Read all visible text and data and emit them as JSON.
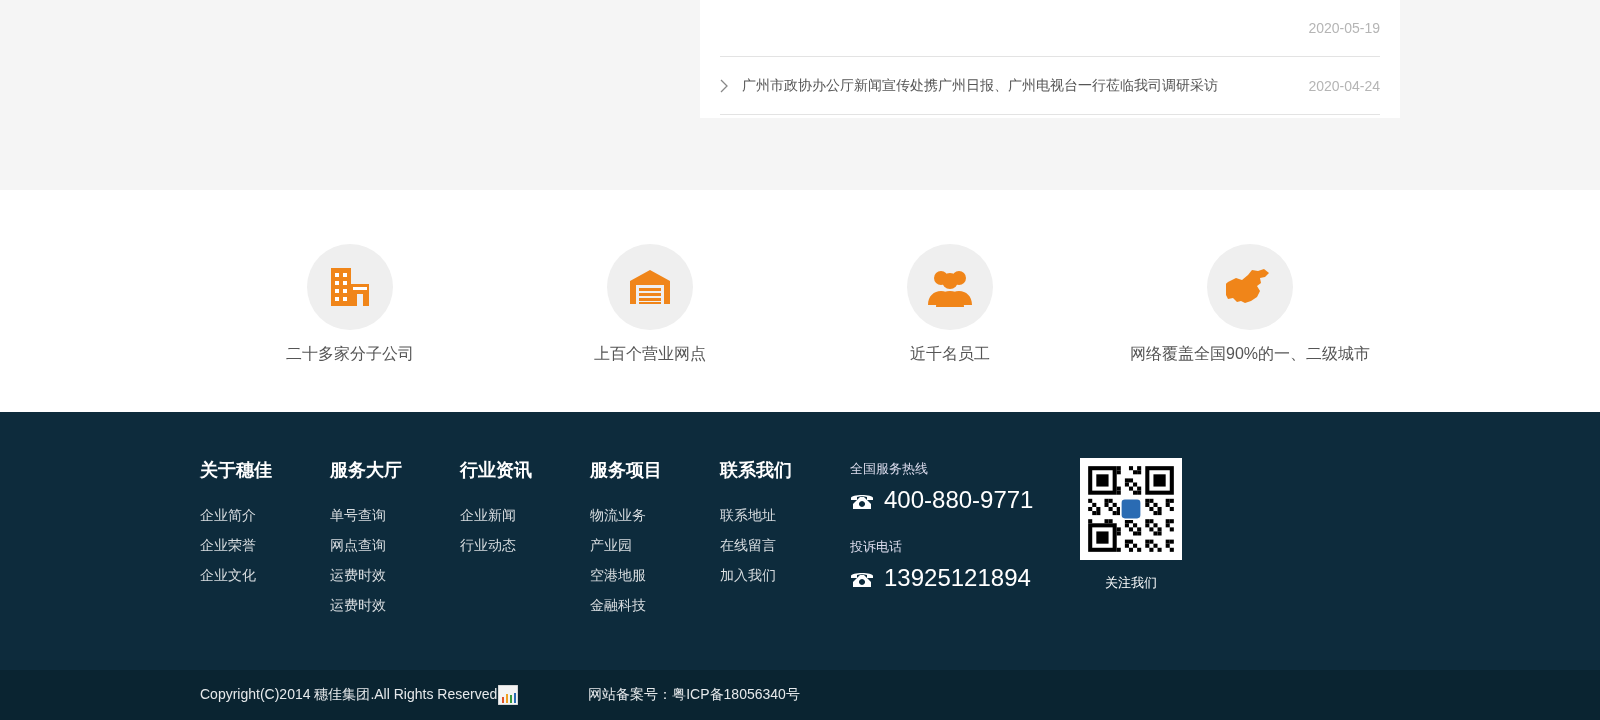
{
  "news": [
    {
      "date": "2020-05-19",
      "arrow": false
    },
    {
      "title": "广州市政协办公厅新闻宣传处携广州日报、广州电视台一行莅临我司调研采访",
      "date": "2020-04-24",
      "arrow": true
    }
  ],
  "stats": [
    {
      "kind": "building",
      "label": "二十多家分子公司"
    },
    {
      "kind": "garage",
      "label": "上百个营业网点"
    },
    {
      "kind": "people",
      "label": "近千名员工"
    },
    {
      "kind": "map",
      "label": "网络覆盖全国90%的一、二级城市"
    }
  ],
  "footer": {
    "columns": [
      {
        "title": "关于穗佳",
        "links": [
          "企业简介",
          "企业荣誉",
          "企业文化"
        ]
      },
      {
        "title": "服务大厅",
        "links": [
          "单号查询",
          "网点查询",
          "运费时效",
          "运费时效"
        ]
      },
      {
        "title": "行业资讯",
        "links": [
          "企业新闻",
          "行业动态"
        ]
      },
      {
        "title": "服务项目",
        "links": [
          "物流业务",
          "产业园",
          "空港地服",
          "金融科技"
        ]
      },
      {
        "title": "联系我们",
        "links": [
          "联系地址",
          "在线留言",
          "加入我们"
        ]
      }
    ],
    "phones": [
      {
        "label": "全国服务热线",
        "number": "400-880-9771"
      },
      {
        "label": "投诉电话",
        "number": "13925121894"
      }
    ],
    "qr_caption": "关注我们"
  },
  "bottom": {
    "copyright": "Copyright(C)2014 穗佳集团.All Rights Reserved",
    "icp": "网站备案号：粤ICP备18056340号"
  }
}
